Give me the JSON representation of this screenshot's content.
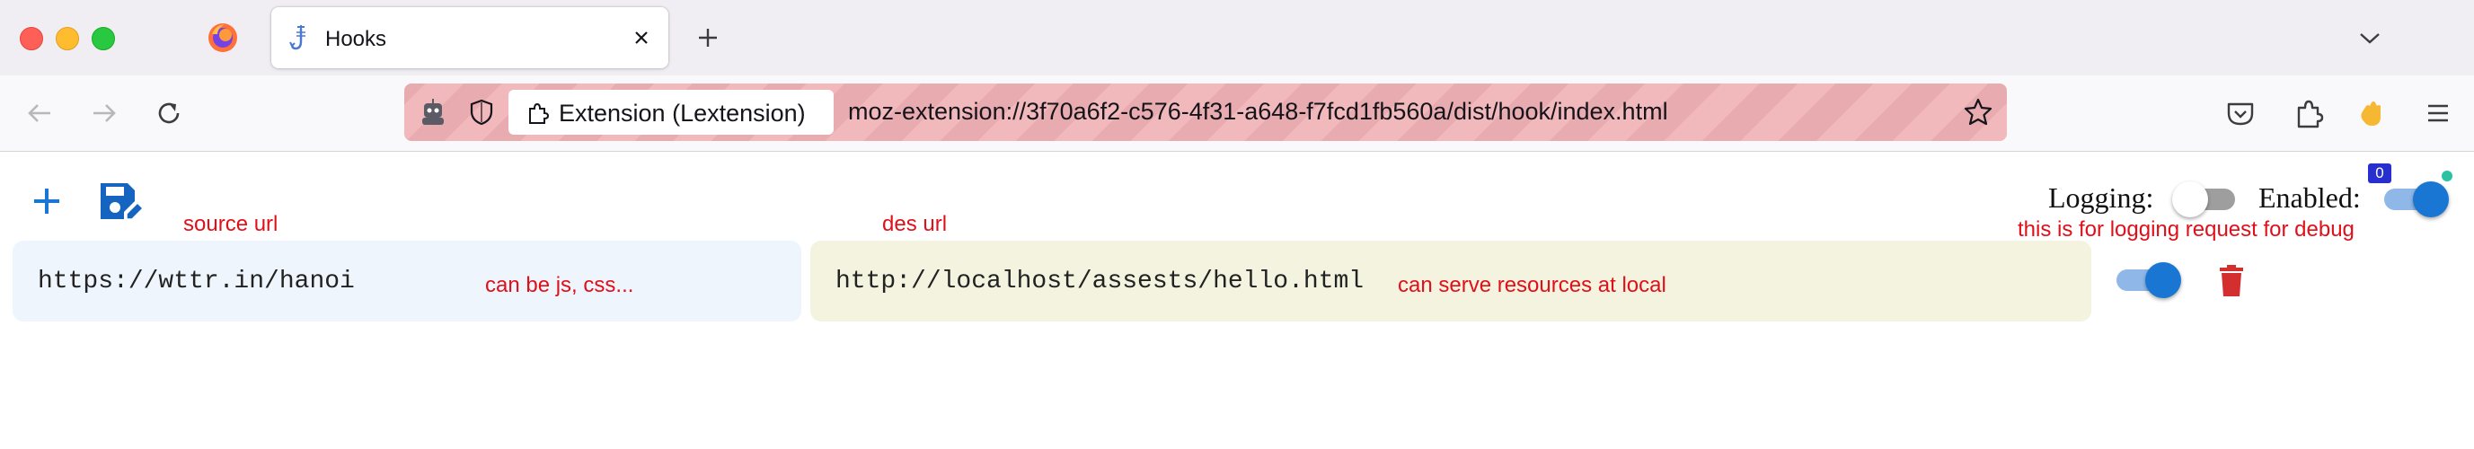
{
  "browser": {
    "tab": {
      "title": "Hooks"
    },
    "urlbar": {
      "identity_label": "Extension (Lextension)",
      "url": "moz-extension://3f70a6f2-c576-4f31-a648-f7fcd1fb560a/dist/hook/index.html"
    },
    "toolbar": {
      "extensions_badge": "0"
    }
  },
  "page": {
    "logging": {
      "label": "Logging:",
      "enabled": false
    },
    "enabled": {
      "label": "Enabled:",
      "enabled": true
    },
    "hooks": [
      {
        "source_url": "https://wttr.in/hanoi",
        "dest_url": "http://localhost/assests/hello.html",
        "active": true
      }
    ]
  },
  "annotations": {
    "source_url": "source url",
    "dest_url": "des url",
    "source_note": "can be js, css...",
    "dest_note": "can serve resources at local",
    "logging_note": "this is for logging request for debug"
  },
  "colors": {
    "accent": "#1976d2",
    "annotation": "#e0101a",
    "source_field_bg": "#eef5fc",
    "dest_field_bg": "#f3f3df",
    "delete": "#d32f2f"
  }
}
